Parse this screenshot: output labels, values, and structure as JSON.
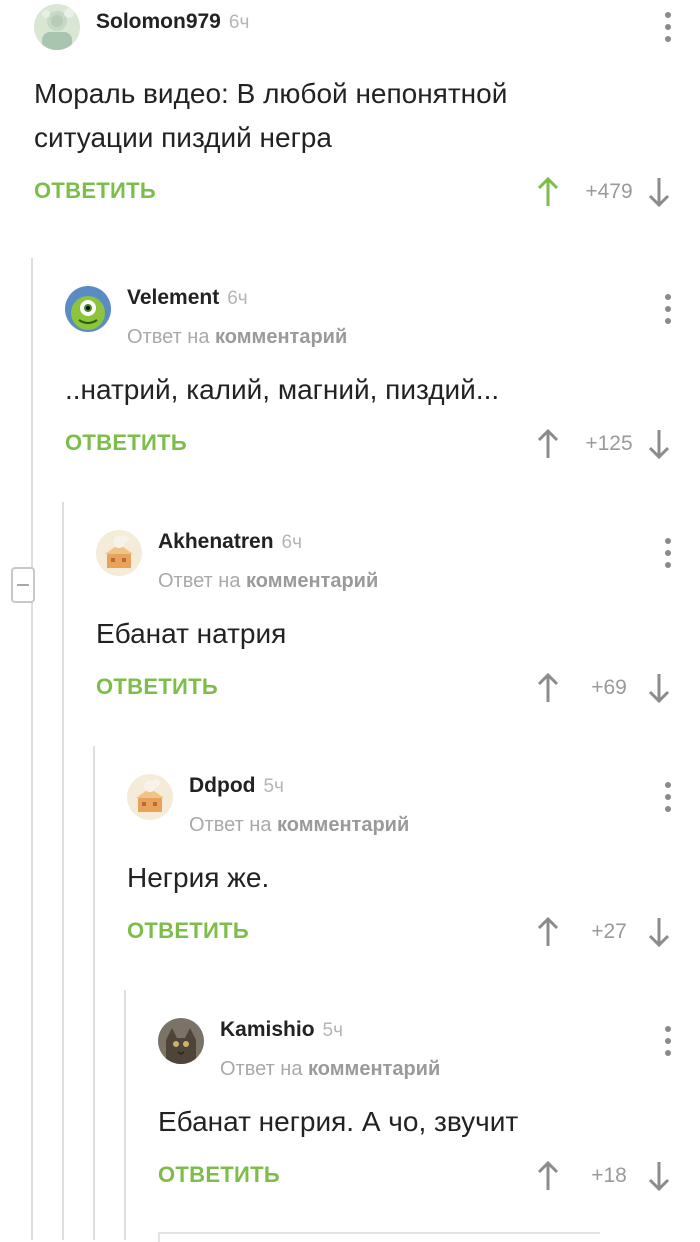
{
  "colors": {
    "accent_green": "#7dbd49",
    "up_arrow_active": "#7dbd49",
    "arrow_inactive": "#8c8c8c",
    "thread_line": "#dedede"
  },
  "icons": {
    "menu": "more-vertical-icon",
    "upvote": "arrow-up-icon",
    "downvote": "arrow-down-icon",
    "collapse": "minus-icon"
  },
  "comments": [
    {
      "author": "Solomon979",
      "time": "6ч",
      "text": "Мораль видео: В любой непонятной ситуации пиздий негра",
      "reply_label": "ОТВЕТИТЬ",
      "rating": "+479"
    },
    {
      "author": "Velement",
      "time": "6ч",
      "reply_prefix": "Ответ на",
      "reply_target": "комментарий",
      "text": "..натрий, калий, магний, пиздий...",
      "reply_label": "ОТВЕТИТЬ",
      "rating": "+125"
    },
    {
      "author": "Akhenatren",
      "time": "6ч",
      "reply_prefix": "Ответ на",
      "reply_target": "комментарий",
      "text": "Ебанат натрия",
      "reply_label": "ОТВЕТИТЬ",
      "rating": "+69"
    },
    {
      "author": "Ddpod",
      "time": "5ч",
      "reply_prefix": "Ответ на",
      "reply_target": "комментарий",
      "text": "Негрия же.",
      "reply_label": "ОТВЕТИТЬ",
      "rating": "+27"
    },
    {
      "author": "Kamishio",
      "time": "5ч",
      "reply_prefix": "Ответ на",
      "reply_target": "комментарий",
      "text": "Ебанат негрия. А чо, звучит",
      "reply_label": "ОТВЕТИТЬ",
      "rating": "+18"
    }
  ]
}
